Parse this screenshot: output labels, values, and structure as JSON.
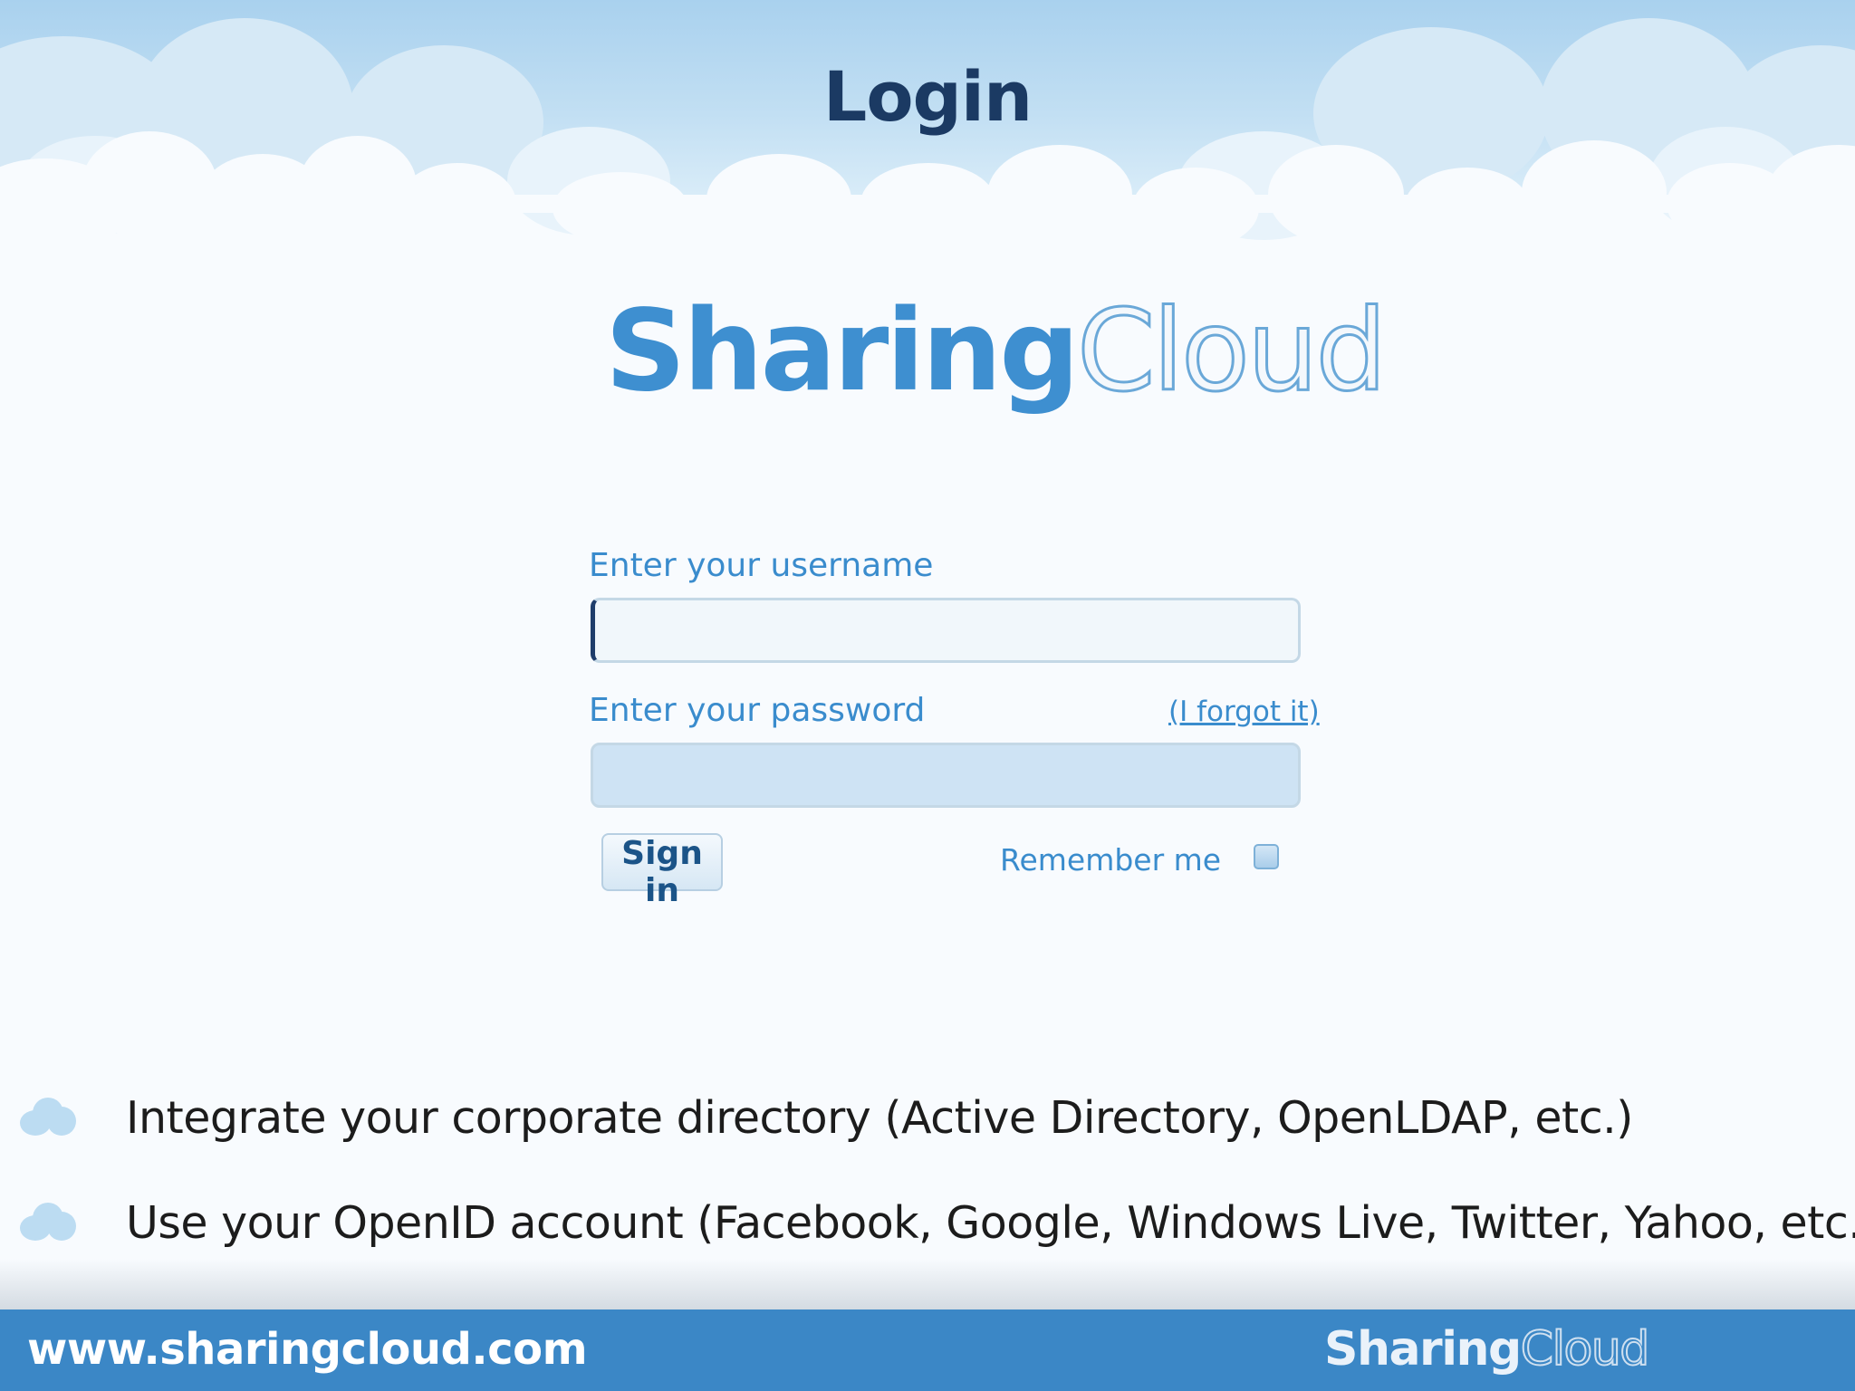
{
  "slide": {
    "title": "Login",
    "logo": {
      "part1": "Sharing",
      "part2": "Cloud"
    }
  },
  "login_form": {
    "username_label": "Enter your username",
    "username_value": "",
    "password_label": "Enter your password",
    "password_value": "",
    "forgot_link": "(I forgot it)",
    "signin_label": "Sign in",
    "remember_label": "Remember me",
    "remember_checked": false
  },
  "bullets": [
    {
      "text": "Integrate your corporate directory (Active Directory, OpenLDAP, etc.)",
      "icon": "cloud-bullet-icon"
    },
    {
      "text": "Use your OpenID account (Facebook, Google, Windows Live, Twitter, Yahoo, etc.)",
      "icon": "cloud-bullet-icon"
    }
  ],
  "footer": {
    "url": "www.sharingcloud.com",
    "logo": {
      "part1": "Sharing",
      "part2": "Cloud"
    }
  },
  "colors": {
    "title": "#1b3a63",
    "accent_blue": "#3a8ccd",
    "footer_bar": "#3b87c6",
    "sky": "#a9d1ee"
  }
}
